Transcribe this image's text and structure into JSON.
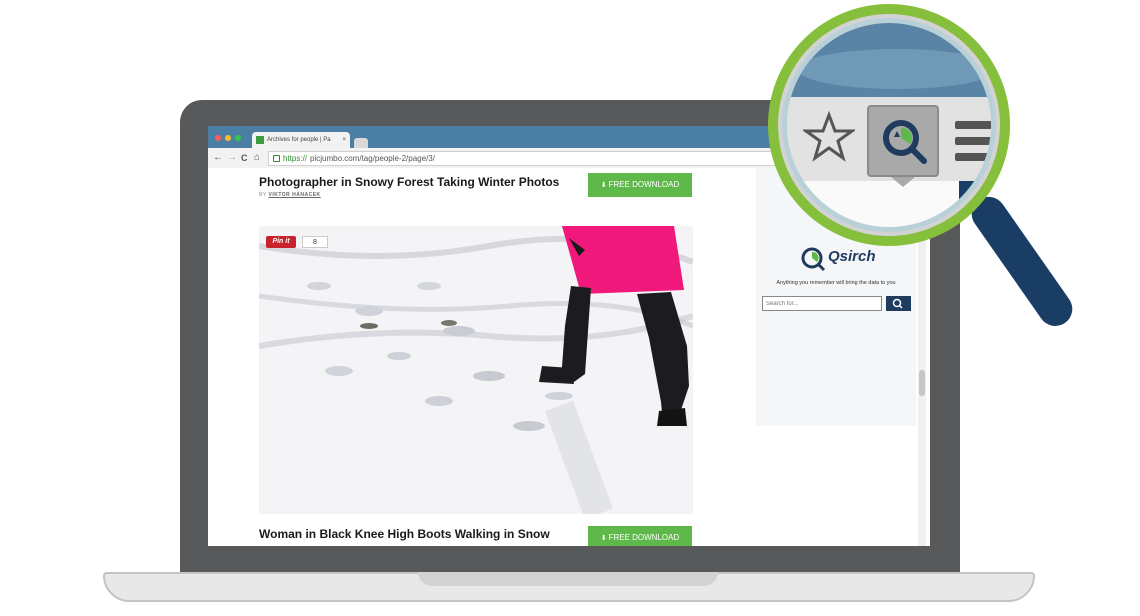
{
  "browser": {
    "tab_title": "Archives for people | Pa",
    "tab_close": "×",
    "url_scheme": "https://",
    "url_rest": "picjumbo.com/tag/people-2/page/3/",
    "nav": {
      "back": "←",
      "forward": "→",
      "reload": "C",
      "home": "⌂"
    }
  },
  "posts": [
    {
      "title": "Photographer in Snowy Forest Taking Winter Photos",
      "byline_prefix": "BY",
      "author": "VIKTOR HANACEK",
      "download_label": "FREE DOWNLOAD"
    },
    {
      "title": "Woman in Black Knee High Boots Walking in Snow",
      "download_label": "FREE DOWNLOAD"
    }
  ],
  "pin": {
    "label": "Pin it",
    "count": "8"
  },
  "extension": {
    "name": "Qsirch",
    "tagline": "Anything you remember will bring the data to you",
    "search_placeholder": "Search for..."
  },
  "icons": {
    "star": "star-icon",
    "extension": "qsirch-icon",
    "menu": "hamburger-menu-icon",
    "download": "download-icon",
    "search": "search-icon"
  },
  "colors": {
    "accent_green": "#5eb94a",
    "brand_navy": "#1f3b5e",
    "ring_green": "#85bf3b",
    "pinterest_red": "#c8232c",
    "coat_pink": "#f0197b"
  }
}
